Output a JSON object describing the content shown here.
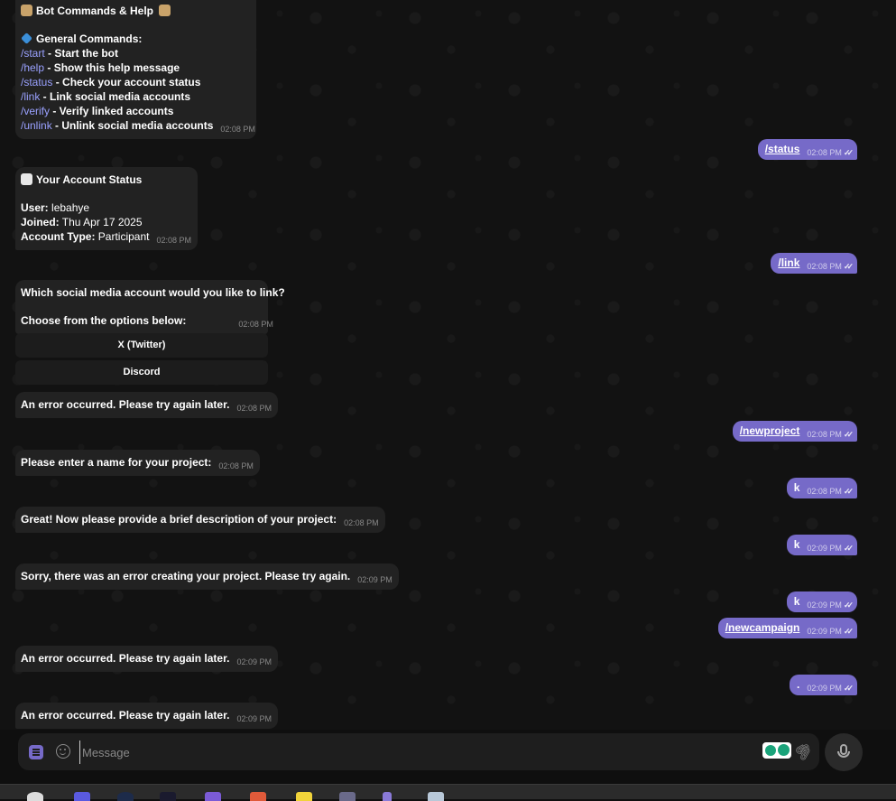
{
  "chat": {
    "help": {
      "title": "Bot Commands & Help",
      "section": "General Commands:",
      "commands": [
        {
          "cmd": "/start",
          "desc": " - Start the bot"
        },
        {
          "cmd": "/help",
          "desc": " - Show this help message"
        },
        {
          "cmd": "/status",
          "desc": " - Check your account status"
        },
        {
          "cmd": "/link",
          "desc": " - Link social media accounts"
        },
        {
          "cmd": "/verify",
          "desc": " - Verify linked accounts"
        },
        {
          "cmd": "/unlink",
          "desc": " - Unlink social media accounts"
        }
      ],
      "time": "02:08 PM"
    },
    "out_status": {
      "text": "/status",
      "time": "02:08 PM"
    },
    "account": {
      "title": "Your Account Status",
      "user_label": "User:",
      "user_value": " lebahye",
      "joined_label": "Joined:",
      "joined_value": " Thu Apr 17 2025",
      "type_label": "Account Type:",
      "type_value": " Participant",
      "time": "02:08 PM"
    },
    "out_link": {
      "text": "/link",
      "time": "02:08 PM"
    },
    "link_prompt": {
      "line1": "Which social media account would you like to link?",
      "line2": "Choose from the options below:",
      "time": "02:08 PM"
    },
    "keyboard": {
      "btn1": "X (Twitter)",
      "btn2": "Discord"
    },
    "error1": {
      "text": "An error occurred. Please try again later.",
      "time": "02:08 PM"
    },
    "out_newproject": {
      "text": "/newproject",
      "time": "02:08 PM"
    },
    "name_prompt": {
      "text": "Please enter a name for your project:",
      "time": "02:08 PM"
    },
    "out_k1": {
      "text": "k",
      "time": "02:08 PM"
    },
    "desc_prompt": {
      "text": "Great! Now please provide a brief description of your project:",
      "time": "02:08 PM"
    },
    "out_k2": {
      "text": "k",
      "time": "02:09 PM"
    },
    "proj_error": {
      "text": "Sorry, there was an error creating your project. Please try again.",
      "time": "02:09 PM"
    },
    "out_k3": {
      "text": "k",
      "time": "02:09 PM"
    },
    "out_newcampaign": {
      "text": "/newcampaign",
      "time": "02:09 PM"
    },
    "error2": {
      "text": "An error occurred. Please try again later.",
      "time": "02:09 PM"
    },
    "out_dot": {
      "text": ".",
      "time": "02:09 PM"
    },
    "error3": {
      "text": "An error occurred. Please try again later.",
      "time": "02:09 PM"
    },
    "ticks": "✓✓"
  },
  "composer": {
    "placeholder": "Message"
  },
  "colors": {
    "outgoing": "#766ac8",
    "incoming": "#222222",
    "command_link": "#9aa1ff"
  }
}
